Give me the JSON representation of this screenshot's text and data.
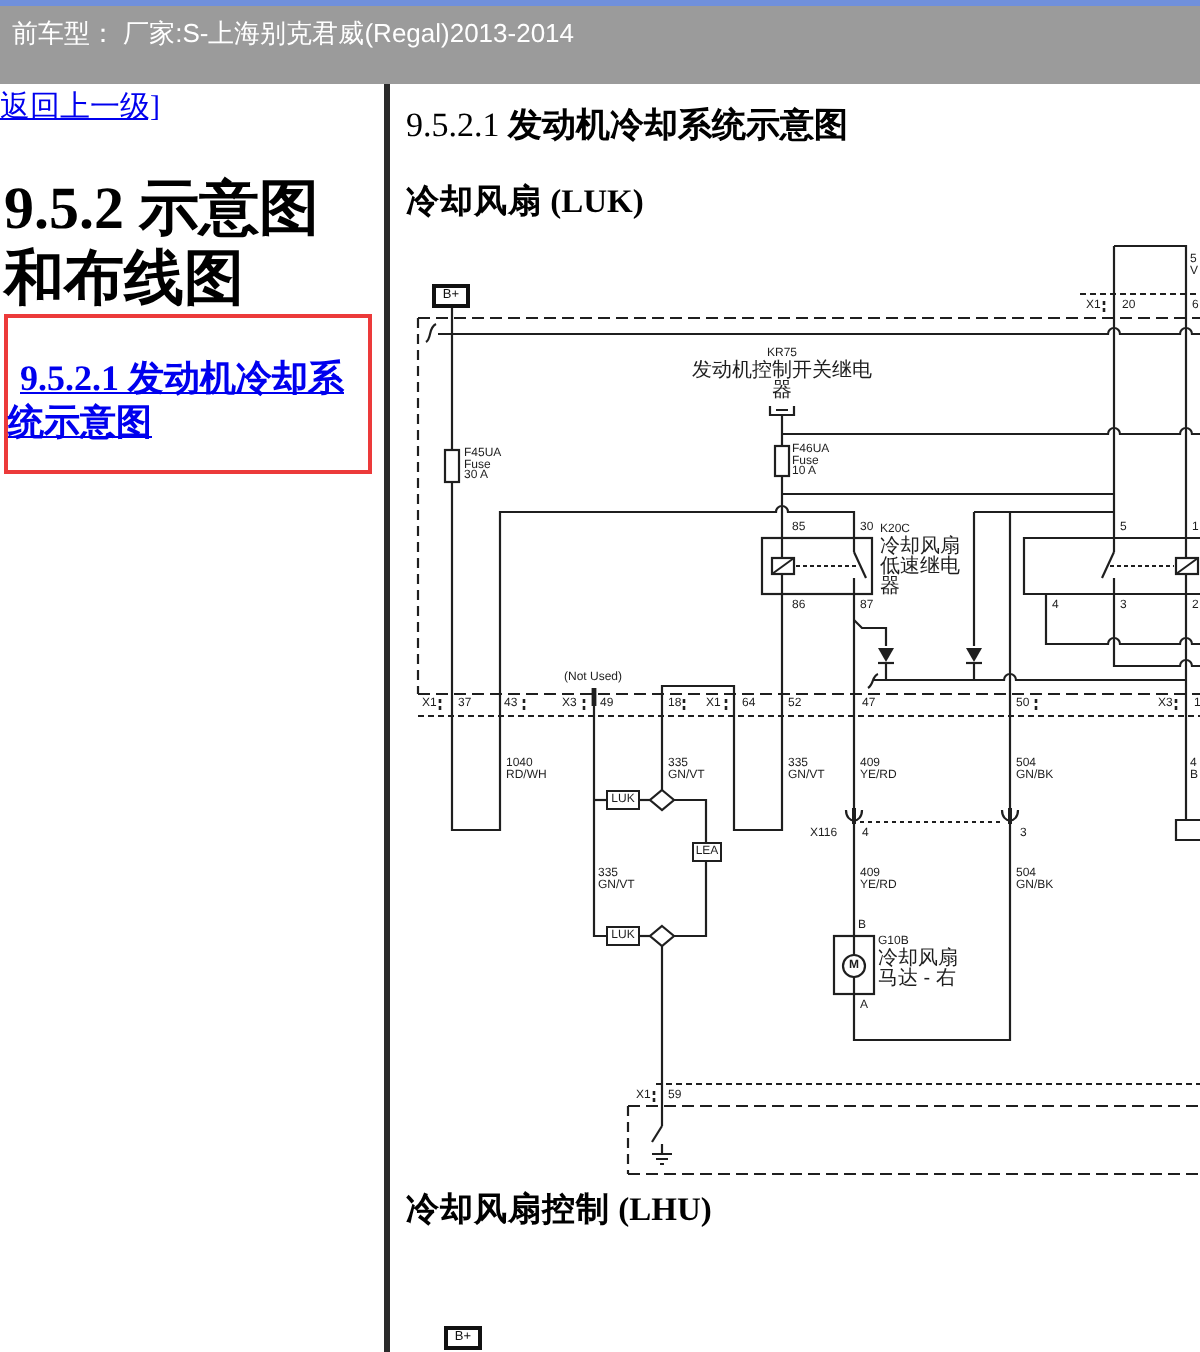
{
  "header": {
    "vehicle": "前车型： 厂家:S-上海别克君威(Regal)2013-2014"
  },
  "sidebar": {
    "back_link": "返回上一级]",
    "heading": "9.5.2 示意图和布线图",
    "links": [
      {
        "label": "9.5.2.1 发动机冷却系统示意图",
        "selected": true
      }
    ]
  },
  "content": {
    "title": "9.5.2.1 **发动机冷却系统示意图**",
    "sections": [
      {
        "heading": "冷却风扇 (LUK)",
        "diagram": {
          "power_label": "B+",
          "fuses": [
            {
              "name": "F45UA",
              "type": "Fuse",
              "rating": "30 A"
            },
            {
              "name": "F46UA",
              "type": "Fuse",
              "rating": "10 A"
            }
          ],
          "relays": [
            {
              "id": "KR75",
              "name": "发动机控制开关继电器"
            },
            {
              "id": "K20C",
              "name": "冷却风扇低速继电器",
              "pins": [
                "85",
                "30",
                "86",
                "87"
              ]
            },
            {
              "pins": [
                "5",
                "1",
                "4",
                "3",
                "2"
              ]
            }
          ],
          "top_connector": [
            "X1",
            "20",
            "6"
          ],
          "edge_labels": [
            "5",
            "V",
            "4",
            "B"
          ],
          "not_used_note": "(Not Used)",
          "connector_row": [
            "X1",
            "37",
            "43",
            "X3",
            "49",
            "18",
            "X1",
            "64",
            "52",
            "47",
            "50",
            "X3",
            "1"
          ],
          "wires": [
            {
              "circuit": "1040",
              "color_code": "RD/WH"
            },
            {
              "circuit": "335",
              "color_code": "GN/VT"
            },
            {
              "circuit": "335",
              "color_code": "GN/VT"
            },
            {
              "circuit": "409",
              "color_code": "YE/RD"
            },
            {
              "circuit": "504",
              "color_code": "GN/BK"
            },
            {
              "circuit": "335",
              "color_code": "GN/VT"
            },
            {
              "circuit": "409",
              "color_code": "YE/RD"
            },
            {
              "circuit": "504",
              "color_code": "GN/BK"
            }
          ],
          "splices": [
            "LUK",
            "LEA",
            "LUK"
          ],
          "inline_connector": {
            "name": "X116",
            "pins": [
              "4",
              "3"
            ]
          },
          "motor": {
            "id": "G10B",
            "name": "冷却风扇马达 - 右",
            "symbol": "M",
            "pins": [
              "B",
              "A"
            ]
          },
          "ground_connector": [
            "X1",
            "59"
          ]
        }
      },
      {
        "heading": "冷却风扇控制 (LHU)",
        "diagram": {
          "power_label": "B+"
        }
      }
    ]
  }
}
